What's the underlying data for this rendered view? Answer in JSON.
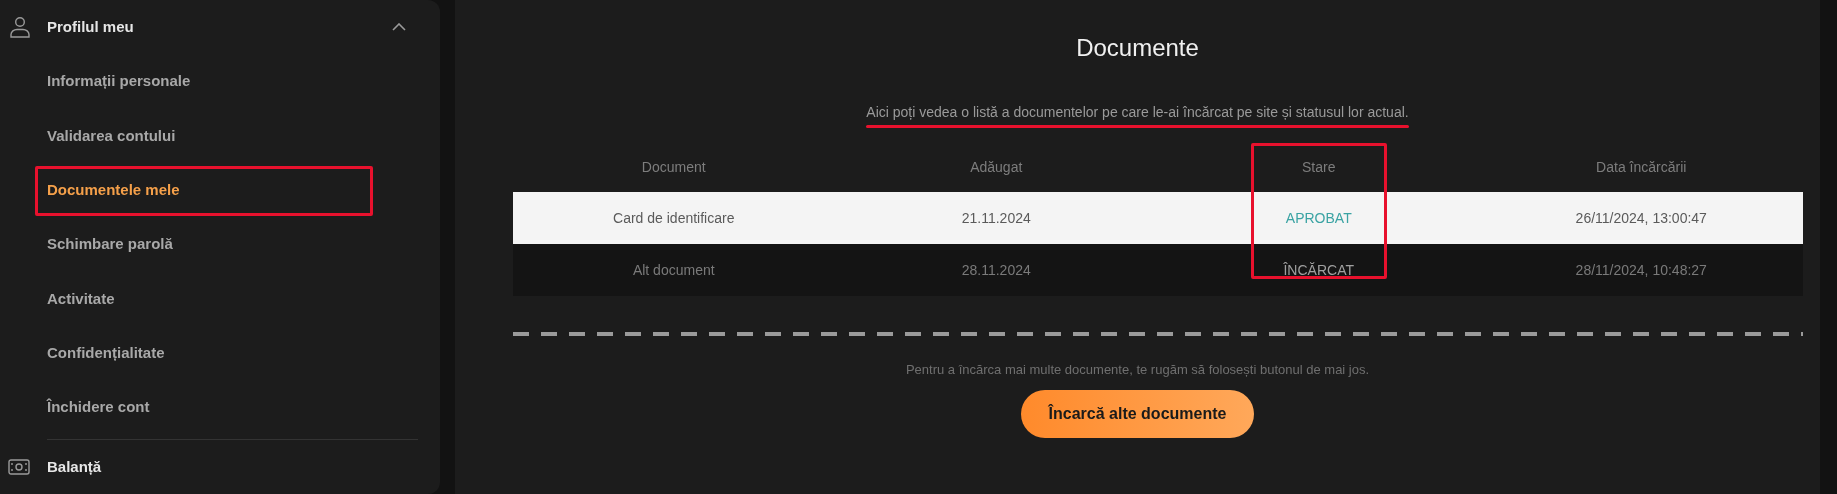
{
  "sidebar": {
    "section": {
      "label": "Profilul meu",
      "expanded": true
    },
    "items": [
      {
        "label": "Informații personale",
        "selected": false,
        "highlighted": false
      },
      {
        "label": "Validarea contului",
        "selected": false,
        "highlighted": false
      },
      {
        "label": "Documentele mele",
        "selected": true,
        "highlighted": true
      },
      {
        "label": "Schimbare parolă",
        "selected": false,
        "highlighted": false
      },
      {
        "label": "Activitate",
        "selected": false,
        "highlighted": false
      },
      {
        "label": "Confidențialitate",
        "selected": false,
        "highlighted": false
      },
      {
        "label": "Închidere cont",
        "selected": false,
        "highlighted": false
      }
    ],
    "next_section": {
      "label": "Balanță"
    }
  },
  "main": {
    "title": "Documente",
    "intro": {
      "text": "Aici poți vedea o listă a documentelor pe care le-ai încărcat pe site și statusul lor actual.",
      "underlined": true
    },
    "table": {
      "columns": [
        {
          "label": "Document",
          "highlighted": false
        },
        {
          "label": "Adăugat",
          "highlighted": false
        },
        {
          "label": "Stare",
          "highlighted": true
        },
        {
          "label": "Data încărcării",
          "highlighted": false
        }
      ],
      "rows": [
        {
          "document": "Card de identificare",
          "added": "21.11.2024",
          "status": {
            "text": "APROBAT",
            "kind": "approved"
          },
          "uploaded": "26/11/2024, 13:00:47"
        },
        {
          "document": "Alt document",
          "added": "28.11.2024",
          "status": {
            "text": "ÎNCĂRCAT",
            "kind": "uploaded"
          },
          "uploaded": "28/11/2024, 10:48:27"
        }
      ]
    },
    "hint": "Pentru a încărca mai multe documente, te rugăm să folosești butonul de mai jos.",
    "upload_button": "Încarcă alte documente"
  }
}
